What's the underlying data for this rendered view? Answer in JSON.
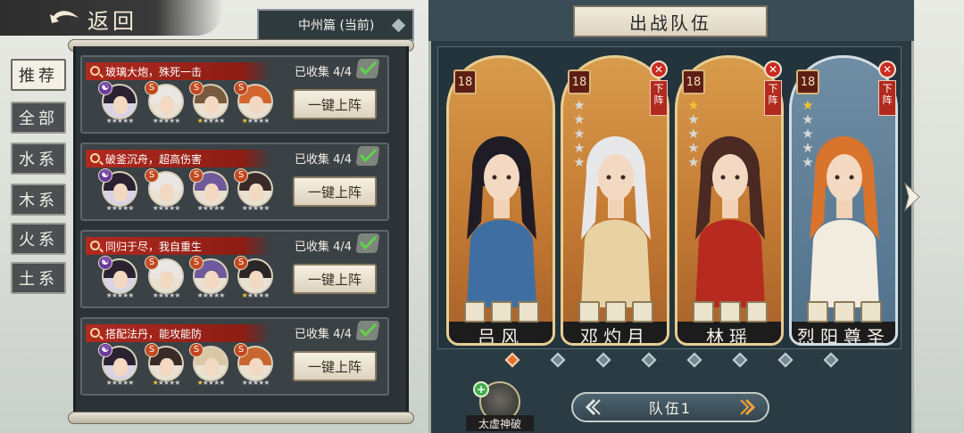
{
  "header": {
    "back_label": "返回",
    "chapter_label": "中州篇 (当前)"
  },
  "tabs": [
    {
      "label": "推荐",
      "active": true
    },
    {
      "label": "全部",
      "active": false
    },
    {
      "label": "水系",
      "active": false
    },
    {
      "label": "木系",
      "active": false
    },
    {
      "label": "火系",
      "active": false
    },
    {
      "label": "土系",
      "active": false
    }
  ],
  "recommendations": [
    {
      "title": "玻璃大炮，殊死一击",
      "collected": "已收集 4/4",
      "button": "一键上阵",
      "heroes": [
        {
          "element": "☯",
          "element_color": "#6b3aa0",
          "hair": "#2a2230",
          "stars": 0
        },
        {
          "element": "S",
          "element_color": "#c2491f",
          "hair": "#e9e6e4",
          "stars": 0
        },
        {
          "element": "S",
          "element_color": "#c2491f",
          "hair": "#7a5a3e",
          "stars": 1
        },
        {
          "element": "S",
          "element_color": "#c2491f",
          "hair": "#d2652e",
          "stars": 1
        }
      ]
    },
    {
      "title": "破釜沉舟，超高伤害",
      "collected": "已收集 4/4",
      "button": "一键上阵",
      "heroes": [
        {
          "element": "☯",
          "element_color": "#6b3aa0",
          "hair": "#2a2230",
          "stars": 0
        },
        {
          "element": "S",
          "element_color": "#c2491f",
          "hair": "#e9e6e4",
          "stars": 0
        },
        {
          "element": "S",
          "element_color": "#c2491f",
          "hair": "#6e5a9a",
          "stars": 0
        },
        {
          "element": "S",
          "element_color": "#c2491f",
          "hair": "#3a2a28",
          "stars": 0
        }
      ]
    },
    {
      "title": "同归于尽，我自重生",
      "collected": "已收集 4/4",
      "button": "一键上阵",
      "heroes": [
        {
          "element": "☯",
          "element_color": "#6b3aa0",
          "hair": "#2a2230",
          "stars": 0
        },
        {
          "element": "S",
          "element_color": "#c2491f",
          "hair": "#e9e6e4",
          "stars": 0
        },
        {
          "element": "S",
          "element_color": "#c2491f",
          "hair": "#6e5a9a",
          "stars": 0
        },
        {
          "element": "S",
          "element_color": "#c2491f",
          "hair": "#2a2626",
          "stars": 1
        }
      ]
    },
    {
      "title": "搭配法丹，能攻能防",
      "collected": "已收集 4/4",
      "button": "一键上阵",
      "heroes": [
        {
          "element": "☯",
          "element_color": "#6b3aa0",
          "hair": "#2a2230",
          "stars": 0
        },
        {
          "element": "S",
          "element_color": "#c2491f",
          "hair": "#3a2a28",
          "stars": 1
        },
        {
          "element": "S",
          "element_color": "#c2491f",
          "hair": "#d8c8a6",
          "stars": 1
        },
        {
          "element": "S",
          "element_color": "#c2491f",
          "hair": "#c8662e",
          "stars": 0
        }
      ]
    }
  ],
  "team": {
    "title": "出战队伍",
    "team_label": "队伍1",
    "remove_label": "下阵",
    "skill_label": "太虚神破",
    "members": [
      {
        "name": "吕风",
        "level": "18",
        "stars": 0,
        "removable": false,
        "style": "gold",
        "hair": "#1f1c26",
        "outfit": "#3f6fa2"
      },
      {
        "name": "邓灼月",
        "level": "18",
        "stars": 0,
        "removable": true,
        "style": "gold",
        "hair": "#e7e6e8",
        "outfit": "#e8d2a4"
      },
      {
        "name": "林瑶",
        "level": "18",
        "stars": 1,
        "removable": true,
        "style": "gold",
        "hair": "#4a2a22",
        "outfit": "#b72a20"
      },
      {
        "name": "烈阳尊圣",
        "level": "18",
        "stars": 1,
        "removable": true,
        "style": "blue",
        "hair": "#d8742c",
        "outfit": "#f2ece0"
      }
    ],
    "pages": 8,
    "active_page": 0
  }
}
